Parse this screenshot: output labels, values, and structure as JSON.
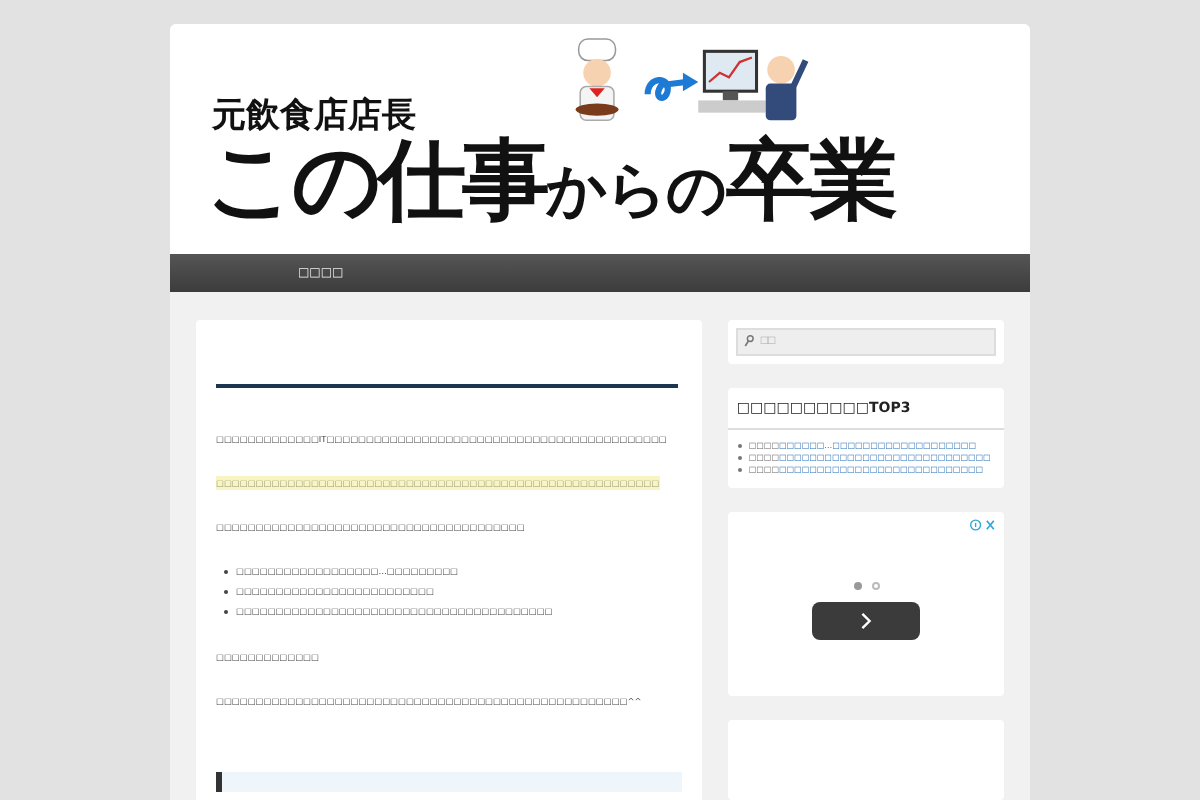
{
  "header": {
    "subtitle": "元飲食店店長",
    "title_parts": [
      {
        "text": "この仕事",
        "kind": "large"
      },
      {
        "text": "からの",
        "kind": "small"
      },
      {
        "text": "卒業",
        "kind": "large"
      }
    ]
  },
  "nav": {
    "items": [
      {
        "label": "□□□□",
        "selected": false
      }
    ]
  },
  "article": {
    "blocks": [
      {
        "kind": "p",
        "text": "□□□□□□□□□□□□□IT□□□□□□□□□□□□□□□□□□□□□□□□□□□□□□□□□□□□□□□□□□□"
      },
      {
        "kind": "highlight",
        "text": "□□□□□□□□□□□□□□□□□□□□□□□□□□□□□□□□□□□□□□□□□□□□□□□□□□□□□□□□"
      },
      {
        "kind": "p",
        "text": "□□□□□□□□□□□□□□□□□□□□□□□□□□□□□□□□□□□□□□□"
      },
      {
        "kind": "list",
        "items": [
          "□□□□□□□□□□□□□□□□□□…□□□□□□□□□",
          "□□□□□□□□□□□□□□□□□□□□□□□□□",
          "□□□□□□□□□□□□□□□□□□□□□□□□□□□□□□□□□□□□□□□□"
        ]
      },
      {
        "kind": "p",
        "text": "□□□□□□□□□□□□□"
      },
      {
        "kind": "p",
        "text": "□□□□□□□□□□□□□□□□□□□□□□□□□□□□□□□□□□□□□□□□□□□□□□□□□□□□^^"
      },
      {
        "kind": "quote"
      }
    ]
  },
  "sidebar": {
    "search": {
      "placeholder": "□□"
    },
    "ranking": {
      "title": "□□□□□□□□□□TOP3",
      "items": [
        {
          "prefix": "□□□□",
          "link": "□□□□□□…□□□□□□□□□□□□□□□□□□□"
        },
        {
          "prefix": "□□□□",
          "link": "□□□□□□□□□□□□□□□□□□□□□□□□□□□□"
        },
        {
          "prefix": "□□□□",
          "link": "□□□□□□□□□□□□□□□□□□□□□□□□□□□"
        }
      ]
    },
    "ad": {
      "dots": [
        {
          "selected": true
        },
        {
          "selected": false
        }
      ]
    }
  }
}
